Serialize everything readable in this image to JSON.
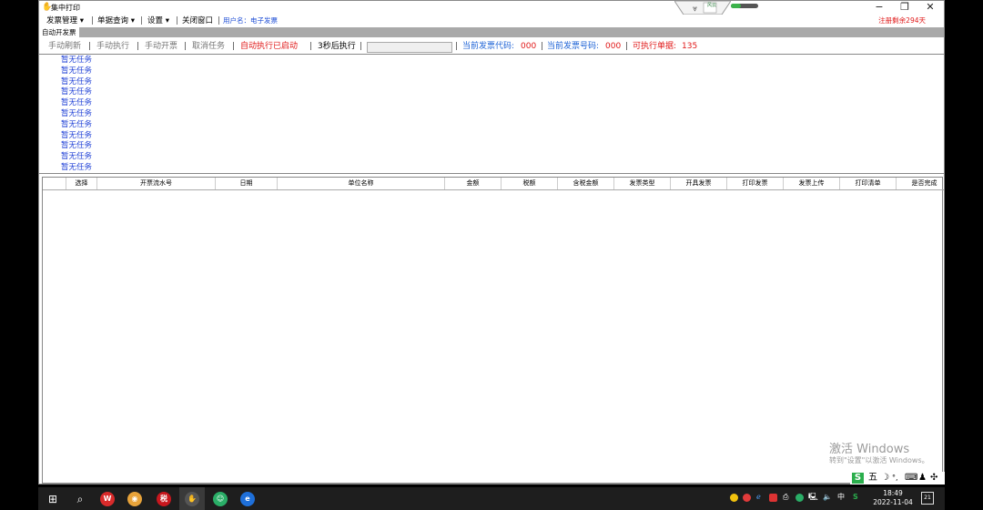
{
  "window": {
    "title": "集中打印",
    "registration_remaining": "注册剩余294天"
  },
  "window_controls": {
    "minimize": "−",
    "restore": "❐",
    "close": "✕"
  },
  "status_widget": {
    "label": "风云"
  },
  "progress": {
    "fraction": 0.35,
    "color": "#3bb34a"
  },
  "menu": {
    "invoice_manage": "发票管理 ▾",
    "doc_query": "单据查询 ▾",
    "settings": "设置 ▾",
    "close_window": "关闭窗口",
    "username": "用户名：电子发票"
  },
  "tab": {
    "label": "自动开发票"
  },
  "toolbar": {
    "manual_refresh": "手动刷新",
    "manual_execute": "手动执行",
    "manual_invoice": "手动开票",
    "cancel_task": "取消任务",
    "auto_started": "自动执行已启动",
    "countdown": "3秒后执行",
    "invoice_code_label": "当前发票代码:",
    "invoice_code_value": "000",
    "invoice_no_label": "当前发票号码:",
    "invoice_no_value": "000",
    "executable_label": "可执行单据:",
    "executable_value": "135"
  },
  "task_log": [
    "暂无任务",
    "暂无任务",
    "暂无任务",
    "暂无任务",
    "暂无任务",
    "暂无任务",
    "暂无任务",
    "暂无任务",
    "暂无任务",
    "暂无任务",
    "暂无任务"
  ],
  "table": {
    "columns": [
      "",
      "选择",
      "开票流水号",
      "日期",
      "单位名称",
      "金额",
      "税额",
      "含税金额",
      "发票类型",
      "开具发票",
      "打印发票",
      "发票上传",
      "打印清单",
      "是否完成"
    ],
    "rows": []
  },
  "watermark": {
    "line1": "激活 Windows",
    "line2": "转到\"设置\"以激活 Windows。"
  },
  "ime": {
    "logo": "S",
    "mode": "五",
    "moon": "☽",
    "punct": "°,",
    "keyboard": "⌨",
    "user": "♟",
    "grid": "✣"
  },
  "taskbar": {
    "start": "⊞",
    "search": "⌕",
    "apps": [
      {
        "name": "wps",
        "glyph": "W",
        "color": "#d92b2b"
      },
      {
        "name": "chrome",
        "glyph": "◉",
        "color": "#e8a33a"
      },
      {
        "name": "invoice-app",
        "glyph": "税",
        "color": "#c8171e"
      },
      {
        "name": "print-app",
        "glyph": "✋",
        "color": "#555555"
      },
      {
        "name": "wechat",
        "glyph": "☺",
        "color": "#2aae67"
      },
      {
        "name": "ie-browser",
        "glyph": "e",
        "color": "#1e6fd9"
      }
    ],
    "tray": {
      "lang": "中",
      "time": "18:49",
      "date": "2022-11-04",
      "notif_count": "21"
    }
  }
}
